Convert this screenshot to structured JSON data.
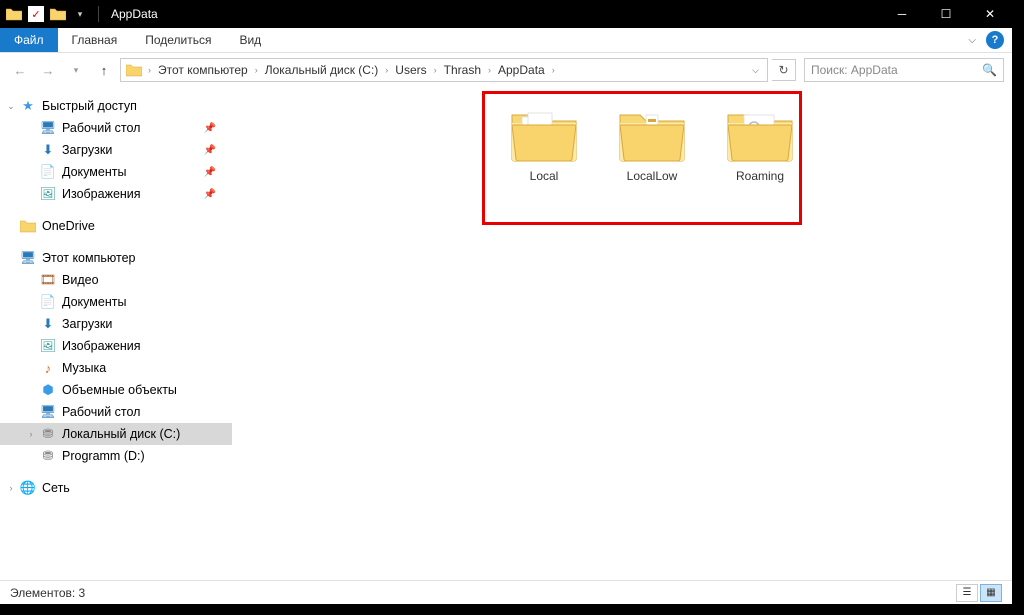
{
  "window": {
    "title": "AppData"
  },
  "ribbon": {
    "file": "Файл",
    "tabs": [
      "Главная",
      "Поделиться",
      "Вид"
    ]
  },
  "breadcrumb": {
    "items": [
      "Этот компьютер",
      "Локальный диск (C:)",
      "Users",
      "Thrash",
      "AppData"
    ]
  },
  "search": {
    "placeholder": "Поиск: AppData"
  },
  "nav": {
    "quick": {
      "label": "Быстрый доступ",
      "items": [
        {
          "label": "Рабочий стол",
          "icon": "desktop",
          "pinned": true
        },
        {
          "label": "Загрузки",
          "icon": "downloads",
          "pinned": true
        },
        {
          "label": "Документы",
          "icon": "documents",
          "pinned": true
        },
        {
          "label": "Изображения",
          "icon": "pictures",
          "pinned": true
        }
      ]
    },
    "onedrive": {
      "label": "OneDrive"
    },
    "pc": {
      "label": "Этот компьютер",
      "items": [
        {
          "label": "Видео",
          "icon": "video"
        },
        {
          "label": "Документы",
          "icon": "documents"
        },
        {
          "label": "Загрузки",
          "icon": "downloads"
        },
        {
          "label": "Изображения",
          "icon": "pictures"
        },
        {
          "label": "Музыка",
          "icon": "music"
        },
        {
          "label": "Объемные объекты",
          "icon": "3d"
        },
        {
          "label": "Рабочий стол",
          "icon": "desktop"
        },
        {
          "label": "Локальный диск (C:)",
          "icon": "drive",
          "selected": true
        },
        {
          "label": "Programm (D:)",
          "icon": "drive"
        }
      ]
    },
    "network": {
      "label": "Сеть"
    }
  },
  "folders": [
    {
      "name": "Local"
    },
    {
      "name": "LocalLow"
    },
    {
      "name": "Roaming"
    }
  ],
  "status": {
    "text": "Элементов: 3"
  }
}
